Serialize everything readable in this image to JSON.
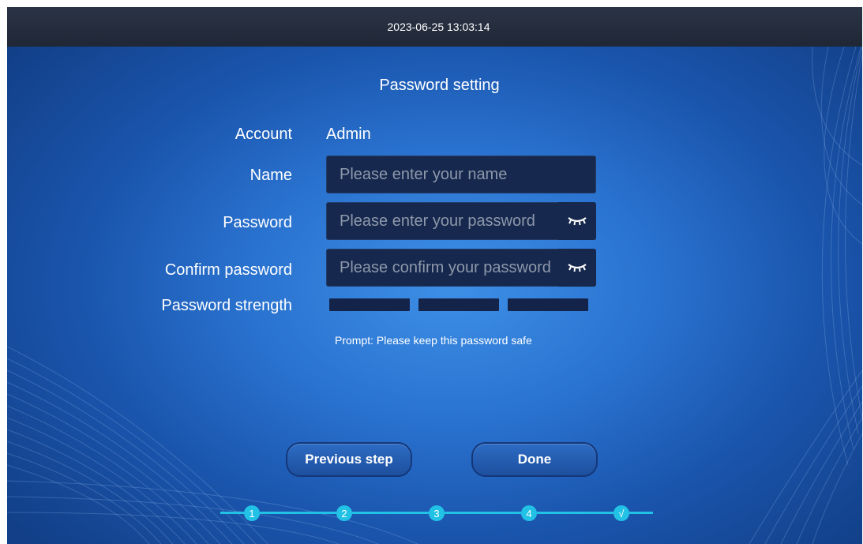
{
  "header": {
    "datetime": "2023-06-25 13:03:14"
  },
  "page": {
    "title": "Password setting"
  },
  "form": {
    "account_label": "Account",
    "account_value": "Admin",
    "name_label": "Name",
    "name_placeholder": "Please enter your name",
    "password_label": "Password",
    "password_placeholder": "Please enter your password",
    "confirm_label": "Confirm password",
    "confirm_placeholder": "Please confirm your password",
    "strength_label": "Password strength",
    "strength_level": 0,
    "prompt": "Prompt: Please keep this password safe"
  },
  "buttons": {
    "previous": "Previous step",
    "done": "Done"
  },
  "steps": [
    "1",
    "2",
    "3",
    "4",
    "√"
  ],
  "colors": {
    "accent": "#22c1e6",
    "field_bg": "#16284d",
    "button_bg": "#1d4f9e"
  },
  "icons": {
    "password_toggle": "eye-closed-icon"
  }
}
